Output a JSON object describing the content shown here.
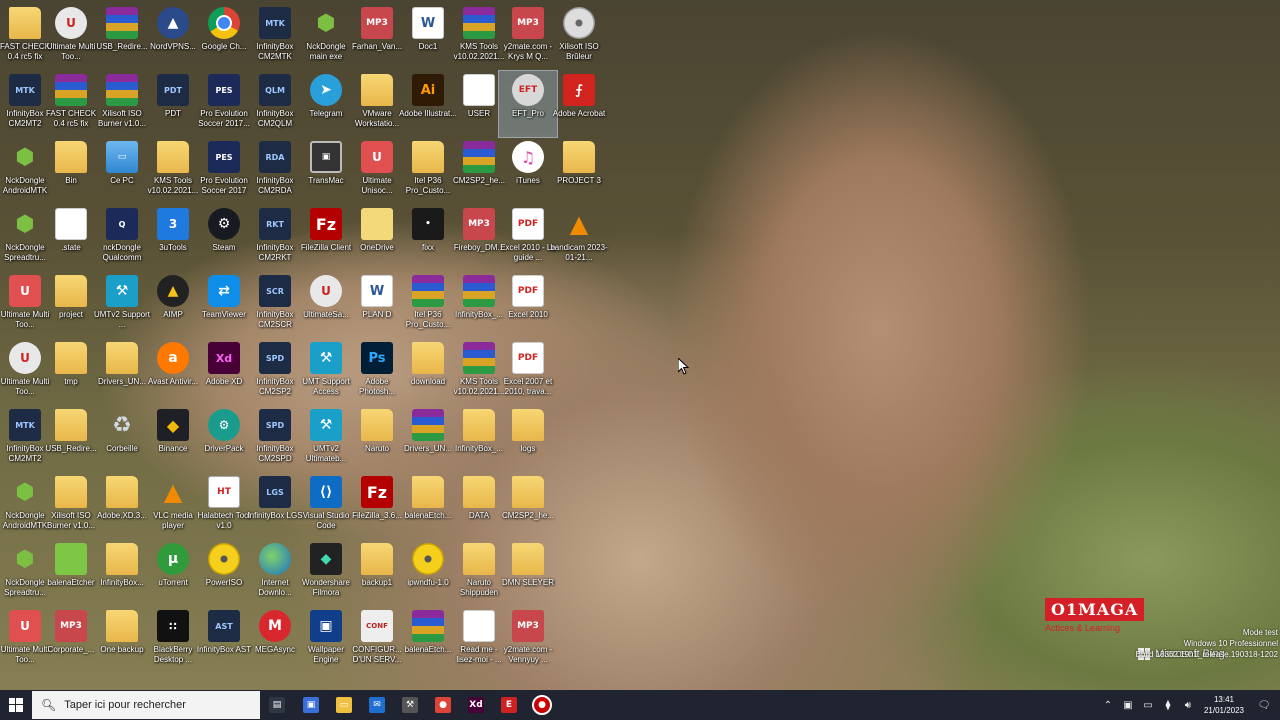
{
  "desktop": {
    "icons": [
      {
        "label": "FAST CHECK 0.4 rc5 fix",
        "icon": "folder-icon"
      },
      {
        "label": "Ultimate Multi Too...",
        "icon": "ultimate-icon"
      },
      {
        "label": "USB_Redire...",
        "icon": "winrar-icon"
      },
      {
        "label": "NordVPNS...",
        "icon": "nordvpn-icon"
      },
      {
        "label": "Google Ch...",
        "icon": "chrome-icon"
      },
      {
        "label": "InfinityBox CM2MTK",
        "icon": "infinitybox-icon",
        "badge": "MTK"
      },
      {
        "label": "NckDongle main exe",
        "icon": "android-icon"
      },
      {
        "label": "Farhan_Van...",
        "icon": "mp3-icon"
      },
      {
        "label": "Doc1",
        "icon": "word-icon"
      },
      {
        "label": "KMS Tools v10.02.2021...",
        "icon": "winrar-icon"
      },
      {
        "label": "y2mate.com - Krys M Q...",
        "icon": "mp3-icon"
      },
      {
        "label": "Xilisoft ISO Brûleur",
        "icon": "disc-icon"
      },
      {
        "label": "InfinityBox CM2MT2",
        "icon": "infinitybox-icon",
        "badge": "MTK"
      },
      {
        "label": "FAST CHECK 0.4 rc5 fix",
        "icon": "winrar-icon"
      },
      {
        "label": "Xilisoft ISO Burner v1.0...",
        "icon": "winrar-icon"
      },
      {
        "label": "PDT",
        "icon": "infinitybox-icon",
        "badge": "PDT"
      },
      {
        "label": "Pro Evolution Soccer 2017...",
        "icon": "pes-icon"
      },
      {
        "label": "InfinityBox CM2QLM",
        "icon": "infinitybox-icon",
        "badge": "QLM"
      },
      {
        "label": "Telegram",
        "icon": "telegram-icon"
      },
      {
        "label": "VMware Workstatio...",
        "icon": "folder-icon"
      },
      {
        "label": "Adobe Illustrat...",
        "icon": "illustrator-icon"
      },
      {
        "label": "USER",
        "icon": "document-icon"
      },
      {
        "label": "EFT_Pro",
        "icon": "eft-icon"
      },
      {
        "label": "Adobe Acrobat",
        "icon": "acrobat-icon"
      },
      {
        "label": "NckDongle AndroidMTK",
        "icon": "android-icon"
      },
      {
        "label": "Bin",
        "icon": "folder-icon"
      },
      {
        "label": "Ce PC",
        "icon": "pc-icon"
      },
      {
        "label": "KMS Tools v10.02.2021...",
        "icon": "folder-icon"
      },
      {
        "label": "Pro Evolution Soccer 2017",
        "icon": "pes-icon"
      },
      {
        "label": "InfinityBox CM2RDA",
        "icon": "infinitybox-icon",
        "badge": "RDA"
      },
      {
        "label": "TransMac",
        "icon": "transmac-icon"
      },
      {
        "label": "Ultimate Unisoc...",
        "icon": "ultimate-tool-icon"
      },
      {
        "label": "Itel P36 Pro_Custo...",
        "icon": "folder-icon"
      },
      {
        "label": "CM2SP2_he...",
        "icon": "winrar-icon"
      },
      {
        "label": "iTunes",
        "icon": "itunes-icon"
      },
      {
        "label": "PROJECT 3",
        "icon": "folder-icon"
      },
      {
        "label": "NckDongle Spreadtru...",
        "icon": "spreadtrum-icon"
      },
      {
        "label": ".state",
        "icon": "document-icon"
      },
      {
        "label": "nckDongle Qualcomm",
        "icon": "qualcomm-icon"
      },
      {
        "label": "3uTools",
        "icon": "3utools-icon"
      },
      {
        "label": "Steam",
        "icon": "steam-icon"
      },
      {
        "label": "InfinityBox CM2RKT",
        "icon": "infinitybox-icon",
        "badge": "RKT"
      },
      {
        "label": "FileZilla Client",
        "icon": "filezilla-icon"
      },
      {
        "label": "OneDrive",
        "icon": "onedrive-icon"
      },
      {
        "label": "fixx",
        "icon": "dark-file-icon"
      },
      {
        "label": "Fireboy_DM...",
        "icon": "mp3-icon"
      },
      {
        "label": "Excel 2010 - Le guide ...",
        "icon": "pdf-icon"
      },
      {
        "label": "bandicam 2023-01-21...",
        "icon": "vlc-icon"
      },
      {
        "label": "Ultimate Multi Too...",
        "icon": "ultimate-tool-icon"
      },
      {
        "label": "project",
        "icon": "folder-icon"
      },
      {
        "label": "UMTv2 Support ...",
        "icon": "umt-icon"
      },
      {
        "label": "AIMP",
        "icon": "aimp-icon"
      },
      {
        "label": "TeamViewer",
        "icon": "teamviewer-icon"
      },
      {
        "label": "InfinityBox CM2SCR",
        "icon": "infinitybox-icon",
        "badge": "SCR"
      },
      {
        "label": "UltimateSa...",
        "icon": "ultimate-icon"
      },
      {
        "label": "PLAN D",
        "icon": "word-icon"
      },
      {
        "label": "Itel P36 Pro_Custo...",
        "icon": "winrar-icon"
      },
      {
        "label": "InfinityBox_...",
        "icon": "winrar-icon"
      },
      {
        "label": "Excel 2010",
        "icon": "pdf-icon"
      },
      {
        "label": "Ultimate Multi Too...",
        "icon": "ultimate-icon"
      },
      {
        "label": "tmp",
        "icon": "folder-icon"
      },
      {
        "label": "Drivers_UN...",
        "icon": "folder-icon"
      },
      {
        "label": "Avast Antivir...",
        "icon": "avast-icon"
      },
      {
        "label": "Adobe XD",
        "icon": "xd-icon"
      },
      {
        "label": "InfinityBox CM2SP2",
        "icon": "infinitybox-icon",
        "badge": "SPD"
      },
      {
        "label": "UMT Support Access",
        "icon": "umt-icon"
      },
      {
        "label": "Adobe Photosh...",
        "icon": "photoshop-icon"
      },
      {
        "label": "download",
        "icon": "folder-icon"
      },
      {
        "label": "KMS Tools v10.02.2021...",
        "icon": "winrar-icon"
      },
      {
        "label": "Excel 2007 et 2010, trava...",
        "icon": "pdf-icon"
      },
      {
        "label": "InfinityBox CM2MT2",
        "icon": "infinitybox-icon",
        "badge": "MTK"
      },
      {
        "label": "USB_Redire...",
        "icon": "folder-icon"
      },
      {
        "label": "Corbeille",
        "icon": "recycle-bin-icon"
      },
      {
        "label": "Binance",
        "icon": "binance-icon"
      },
      {
        "label": "DriverPack",
        "icon": "driverpack-icon"
      },
      {
        "label": "InfinityBox CM2SPD",
        "icon": "infinitybox-icon",
        "badge": "SPD"
      },
      {
        "label": "UMTv2 Ultimateb...",
        "icon": "umt-icon"
      },
      {
        "label": "Naruto",
        "icon": "folder-icon"
      },
      {
        "label": "Drivers_UN...",
        "icon": "winrar-icon"
      },
      {
        "label": "InfinityBox_...",
        "icon": "folder-icon"
      },
      {
        "label": "logs",
        "icon": "folder-icon"
      },
      {
        "label": "NckDongle AndroidMTK",
        "icon": "android-icon"
      },
      {
        "label": "Xilisoft ISO Burner v1.0...",
        "icon": "folder-icon"
      },
      {
        "label": "Adobe.XD.3...",
        "icon": "folder-icon"
      },
      {
        "label": "VLC media player",
        "icon": "vlc-icon"
      },
      {
        "label": "Halabtech Tool v1.0",
        "icon": "halabtech-icon"
      },
      {
        "label": "InfinityBox LGS",
        "icon": "infinitybox-icon",
        "badge": "LGS"
      },
      {
        "label": "Visual Studio Code",
        "icon": "vscode-icon"
      },
      {
        "label": "FileZilla_3.6...",
        "icon": "filezilla-icon"
      },
      {
        "label": "balenaEtch...",
        "icon": "folder-icon"
      },
      {
        "label": "DATA",
        "icon": "folder-icon"
      },
      {
        "label": "CM2SP2_he...",
        "icon": "folder-icon"
      },
      {
        "label": "NckDongle Spreadtru...",
        "icon": "spreadtrum-icon"
      },
      {
        "label": "balenaEtcher",
        "icon": "balena-icon"
      },
      {
        "label": "InfinityBox...",
        "icon": "folder-icon"
      },
      {
        "label": "uTorrent",
        "icon": "utorrent-icon"
      },
      {
        "label": "PowerISO",
        "icon": "poweriso-icon"
      },
      {
        "label": "Internet Downlo...",
        "icon": "globe-icon"
      },
      {
        "label": "Wondershare Filmora",
        "icon": "filmora-icon"
      },
      {
        "label": "backup1",
        "icon": "folder-icon"
      },
      {
        "label": "ipwndfu-1.0",
        "icon": "poweriso-icon"
      },
      {
        "label": "Naruto Shippuden",
        "icon": "folder-icon"
      },
      {
        "label": "DMN SLEYER",
        "icon": "folder-icon"
      },
      {
        "label": "Ultimate Multi Too...",
        "icon": "ultimate-tool-icon"
      },
      {
        "label": "Corporate_...",
        "icon": "mp3-icon"
      },
      {
        "label": "One backup",
        "icon": "folder-icon"
      },
      {
        "label": "BlackBerry Desktop ...",
        "icon": "blackberry-icon"
      },
      {
        "label": "InfinityBox AST",
        "icon": "infinitybox-icon",
        "badge": "AST"
      },
      {
        "label": "MEGAsync",
        "icon": "mega-icon"
      },
      {
        "label": "Wallpaper Engine",
        "icon": "wallpaper-engine-icon"
      },
      {
        "label": "CONFIGUR... D'UN SERV...",
        "icon": "config-icon"
      },
      {
        "label": "balenaEtch...",
        "icon": "winrar-icon"
      },
      {
        "label": "Read me - lisez-moi - ...",
        "icon": "document-icon"
      },
      {
        "label": "y2mate.com - Vennyuy ...",
        "icon": "mp3-icon"
      }
    ],
    "selected_label": "EFT_Pro"
  },
  "overlay": {
    "brand": "O1MAGA",
    "tagline": "Actices & Learning",
    "bing": "Microsoft Bing"
  },
  "watermark": {
    "line1": "Mode test",
    "line2": "Windows 10 Professionnel",
    "line3": "Build 18362.19h1_release.190318-1202"
  },
  "taskbar": {
    "search_placeholder": "Taper ici pour rechercher",
    "apps": [
      "task-view-icon",
      "store-icon",
      "file-explorer-icon",
      "mail-icon",
      "tool-icon",
      "chrome-icon",
      "xd-icon",
      "eft-icon",
      "record-icon"
    ],
    "time": "13:41",
    "date": "21/01/2023"
  }
}
